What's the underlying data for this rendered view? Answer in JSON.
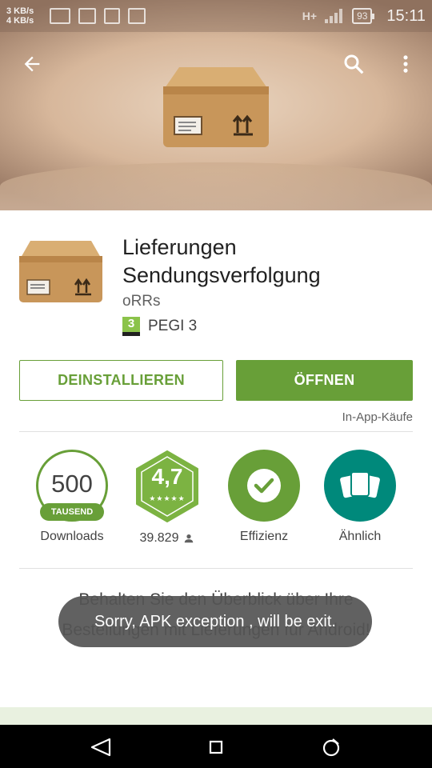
{
  "status_bar": {
    "speed_up": "3 KB/s",
    "speed_down": "4 KB/s",
    "network": "H+",
    "battery": "93",
    "time": "15:11"
  },
  "header": {
    "back_icon": "arrow-back-icon",
    "search_icon": "search-icon",
    "more_icon": "more-vert-icon"
  },
  "app": {
    "title": "Lieferungen Sendungsverfolgung",
    "developer": "oRRs",
    "pegi_number": "3",
    "pegi_label": "PEGI 3",
    "uninstall_label": "DEINSTALLIEREN",
    "open_label": "ÖFFNEN",
    "in_app_label": "In-App-Käufe"
  },
  "stats": {
    "downloads_number": "500",
    "downloads_unit": "TAUSEND",
    "downloads_label": "Downloads",
    "rating": "4,7",
    "rating_stars": "★★★★★",
    "rating_count": "39.829",
    "category_label": "Effizienz",
    "similar_label": "Ähnlich"
  },
  "description": "Behalten Sie den Überblick über Ihre Bestellungen mit Lieferungen für Android!",
  "toast": "Sorry, APK exception , will be exit.",
  "colors": {
    "accent_green": "#689f38",
    "teal": "#00897b",
    "rating_green": "#7cb342"
  }
}
